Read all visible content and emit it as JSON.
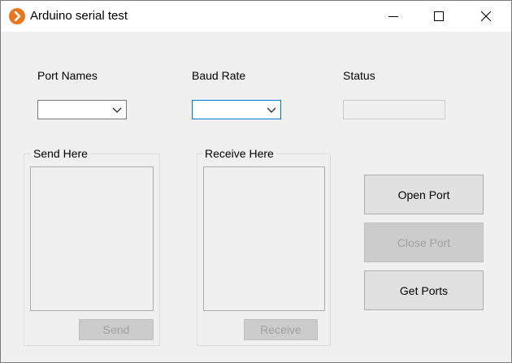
{
  "window": {
    "title": "Arduino serial test",
    "app_icon": "chevron-right-circle-icon",
    "controls": {
      "minimize": "minimize-icon",
      "maximize": "maximize-icon",
      "close": "close-icon"
    }
  },
  "form": {
    "port_names": {
      "label": "Port Names",
      "value": ""
    },
    "baud_rate": {
      "label": "Baud Rate",
      "value": ""
    },
    "status": {
      "label": "Status",
      "value": ""
    },
    "send_group": {
      "title": "Send Here",
      "text": "",
      "button_label": "Send"
    },
    "receive_group": {
      "title": "Receive Here",
      "text": "",
      "button_label": "Receive"
    },
    "buttons": {
      "open_port": "Open Port",
      "close_port": "Close Port",
      "get_ports": "Get Ports"
    }
  },
  "colors": {
    "accent": "#0078d7",
    "icon_orange": "#e8761e",
    "window_bg": "#f0f0f0",
    "titlebar_bg": "#ffffff"
  }
}
